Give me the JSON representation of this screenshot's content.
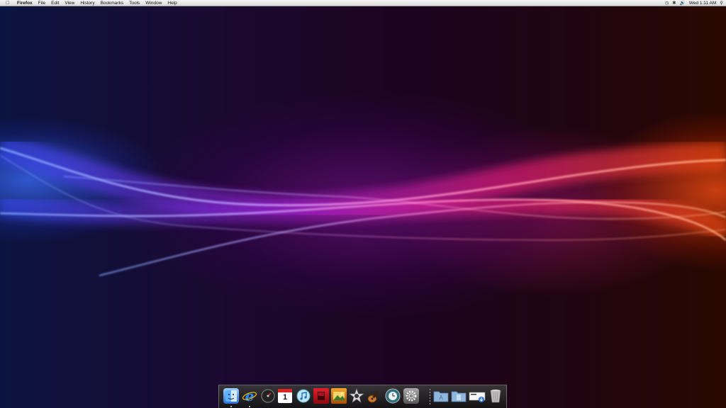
{
  "menubar": {
    "apple_icon": "apple-icon",
    "items": [
      "Firefox",
      "File",
      "Edit",
      "View",
      "History",
      "Bookmarks",
      "Tools",
      "Window",
      "Help"
    ],
    "status": {
      "icons": [
        "time-machine-icon",
        "bluetooth-icon",
        "volume-icon",
        "spotlight-icon"
      ],
      "clock": "Wed 1:11 AM"
    }
  },
  "dock": {
    "apps": [
      {
        "name": "finder-icon",
        "running": true
      },
      {
        "name": "internet-explorer-icon",
        "running": true
      },
      {
        "name": "dashboard-icon",
        "running": false
      },
      {
        "name": "ical-icon",
        "running": false,
        "text": "1"
      },
      {
        "name": "itunes-icon",
        "running": false
      },
      {
        "name": "photo-booth-icon",
        "running": false
      },
      {
        "name": "iphoto-icon",
        "running": false
      },
      {
        "name": "imovie-icon",
        "running": false
      },
      {
        "name": "garageband-icon",
        "running": false
      },
      {
        "name": "time-machine-icon",
        "running": false
      },
      {
        "name": "system-preferences-icon",
        "running": false
      }
    ],
    "stacks": [
      "applications-folder-icon",
      "documents-folder-icon",
      "downloads-stack-icon",
      "trash-icon"
    ]
  }
}
